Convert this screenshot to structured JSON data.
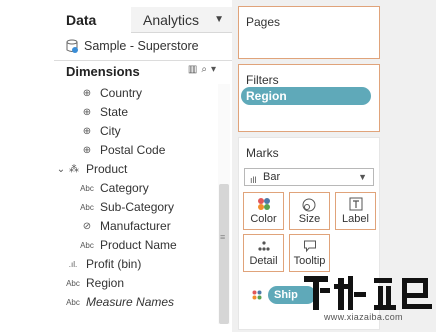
{
  "tabs": {
    "data": "Data",
    "analytics": "Analytics"
  },
  "datasource": {
    "name": "Sample - Superstore"
  },
  "dimensions": {
    "title": "Dimensions",
    "fields": [
      {
        "label": "Country",
        "icon": "globe-icon"
      },
      {
        "label": "State",
        "icon": "globe-icon"
      },
      {
        "label": "City",
        "icon": "globe-icon"
      },
      {
        "label": "Postal Code",
        "icon": "globe-icon"
      },
      {
        "label": "Product",
        "icon": "hierarchy-icon"
      },
      {
        "label": "Category",
        "icon": "abc-icon"
      },
      {
        "label": "Sub-Category",
        "icon": "abc-icon"
      },
      {
        "label": "Manufacturer",
        "icon": "paperclip-icon"
      },
      {
        "label": "Product Name",
        "icon": "abc-icon"
      },
      {
        "label": "Profit (bin)",
        "icon": "bin-icon"
      },
      {
        "label": "Region",
        "icon": "abc-icon"
      },
      {
        "label": "Measure Names",
        "icon": "abc-icon"
      }
    ]
  },
  "shelves": {
    "pages_title": "Pages",
    "filters_title": "Filters",
    "filter_pill": "Region"
  },
  "marks": {
    "title": "Marks",
    "type": "Bar",
    "buttons": {
      "color": "Color",
      "size": "Size",
      "label": "Label",
      "detail": "Detail",
      "tooltip": "Tooltip"
    },
    "pill": "Ship"
  },
  "watermark": {
    "url": "www.xiazaiba.com"
  },
  "colors": {
    "accent_border": "#e0a37a",
    "pill": "#5fa9b9"
  }
}
